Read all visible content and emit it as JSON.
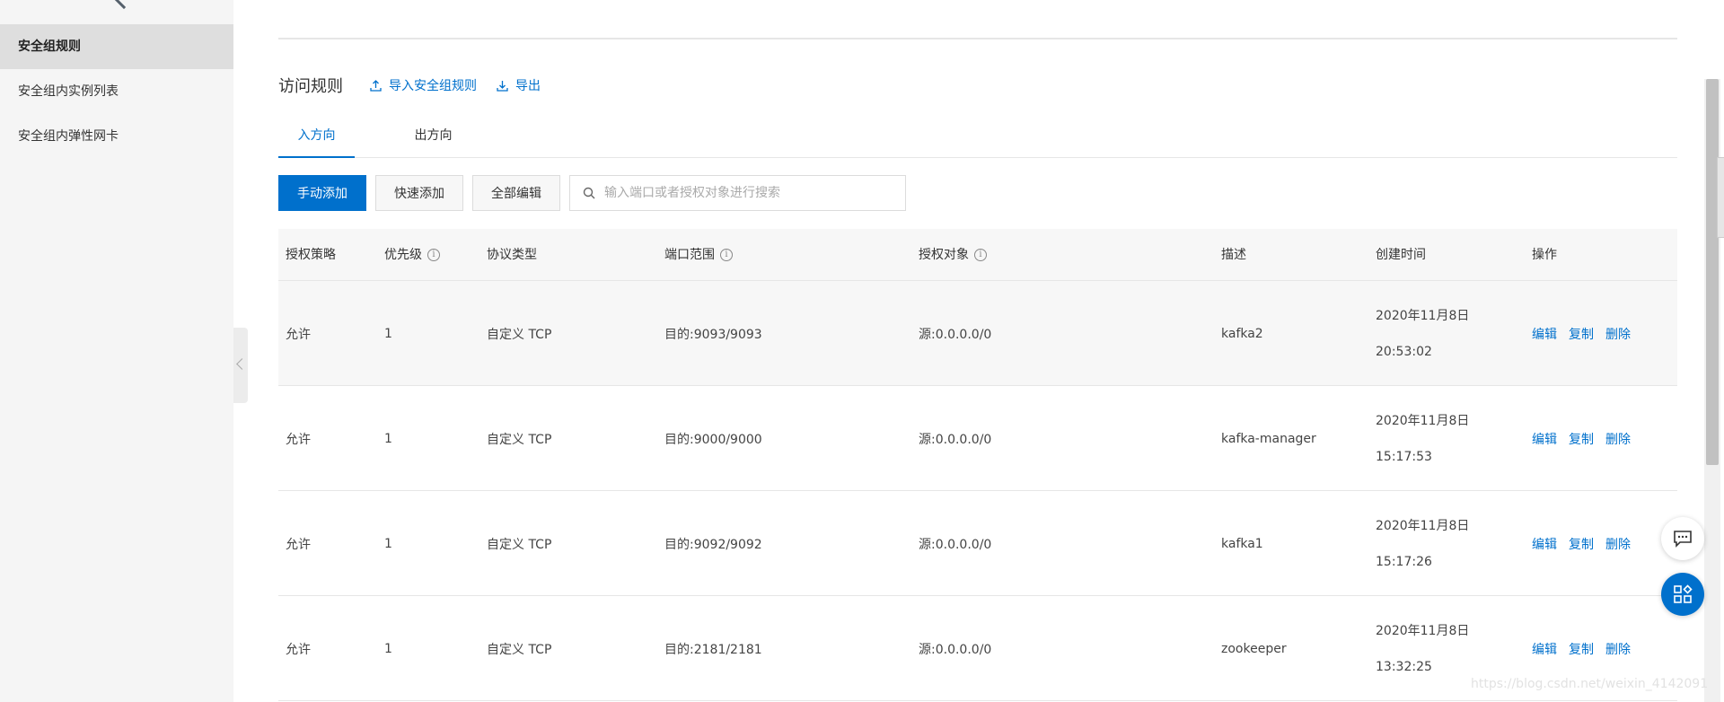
{
  "sidebar": {
    "items": [
      {
        "label": "安全组规则",
        "active": true
      },
      {
        "label": "安全组内实例列表",
        "active": false
      },
      {
        "label": "安全组内弹性网卡",
        "active": false
      }
    ]
  },
  "header": {
    "title": "访问规则",
    "import_label": "导入安全组规则",
    "export_label": "导出"
  },
  "tabs": [
    {
      "label": "入方向",
      "active": true
    },
    {
      "label": "出方向",
      "active": false
    }
  ],
  "toolbar": {
    "manual_add": "手动添加",
    "quick_add": "快速添加",
    "edit_all": "全部编辑",
    "search_placeholder": "输入端口或者授权对象进行搜索"
  },
  "table": {
    "columns": [
      "授权策略",
      "优先级",
      "协议类型",
      "端口范围",
      "授权对象",
      "描述",
      "创建时间",
      "操作"
    ],
    "rows": [
      {
        "policy": "允许",
        "priority": "1",
        "protocol": "自定义 TCP",
        "port": "目的:9093/9093",
        "target": "源:0.0.0.0/0",
        "desc": "kafka2",
        "date": "2020年11月8日",
        "time": "20:53:02"
      },
      {
        "policy": "允许",
        "priority": "1",
        "protocol": "自定义 TCP",
        "port": "目的:9000/9000",
        "target": "源:0.0.0.0/0",
        "desc": "kafka-manager",
        "date": "2020年11月8日",
        "time": "15:17:53"
      },
      {
        "policy": "允许",
        "priority": "1",
        "protocol": "自定义 TCP",
        "port": "目的:9092/9092",
        "target": "源:0.0.0.0/0",
        "desc": "kafka1",
        "date": "2020年11月8日",
        "time": "15:17:26"
      },
      {
        "policy": "允许",
        "priority": "1",
        "protocol": "自定义 TCP",
        "port": "目的:2181/2181",
        "target": "源:0.0.0.0/0",
        "desc": "zookeeper",
        "date": "2020年11月8日",
        "time": "13:32:25"
      }
    ],
    "ops": {
      "edit": "编辑",
      "copy": "复制",
      "delete": "删除"
    }
  },
  "watermark": "https://blog.csdn.net/weixin_4142091",
  "colors": {
    "accent": "#0070cc",
    "sidebar_bg": "#f5f5f5",
    "active_item_bg": "#dedede"
  },
  "icons": {
    "import": "upload-icon",
    "export": "download-icon",
    "search": "search-icon",
    "chat": "chat-icon",
    "apps": "apps-icon",
    "info": "info-icon"
  }
}
